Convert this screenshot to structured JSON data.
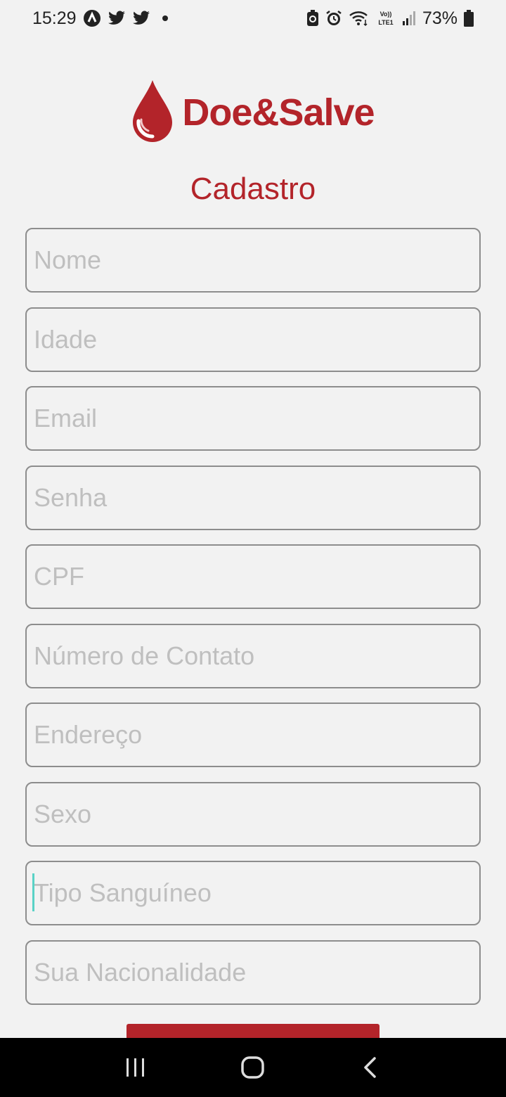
{
  "status_bar": {
    "time": "15:29",
    "left_icons": [
      "vpn-icon",
      "twitter-icon",
      "twitter-icon",
      "notification-dot-icon"
    ],
    "right_icons": [
      "battery-saver-icon",
      "alarm-icon",
      "wifi-icon",
      "volte-lte-icon",
      "signal-icon"
    ],
    "battery": "73%"
  },
  "brand": {
    "name": "Doe&Salve",
    "logo": "blood-drop-icon",
    "color": "#b3242a"
  },
  "page": {
    "title": "Cadastro"
  },
  "form": {
    "fields": [
      {
        "name": "nome",
        "placeholder": "Nome",
        "value": ""
      },
      {
        "name": "idade",
        "placeholder": "Idade",
        "value": ""
      },
      {
        "name": "email",
        "placeholder": "Email",
        "value": ""
      },
      {
        "name": "senha",
        "placeholder": "Senha",
        "value": ""
      },
      {
        "name": "cpf",
        "placeholder": "CPF",
        "value": ""
      },
      {
        "name": "contato",
        "placeholder": "Número de Contato",
        "value": ""
      },
      {
        "name": "endereco",
        "placeholder": "Endereço",
        "value": ""
      },
      {
        "name": "sexo",
        "placeholder": "Sexo",
        "value": ""
      },
      {
        "name": "tipo-sanguineo",
        "placeholder": "Tipo Sanguíneo",
        "value": "",
        "focused": true
      },
      {
        "name": "nacionalidade",
        "placeholder": "Sua Nacionalidade",
        "value": ""
      }
    ]
  },
  "nav_bar": {
    "buttons": [
      "recent-apps-icon",
      "home-icon",
      "back-icon"
    ]
  }
}
